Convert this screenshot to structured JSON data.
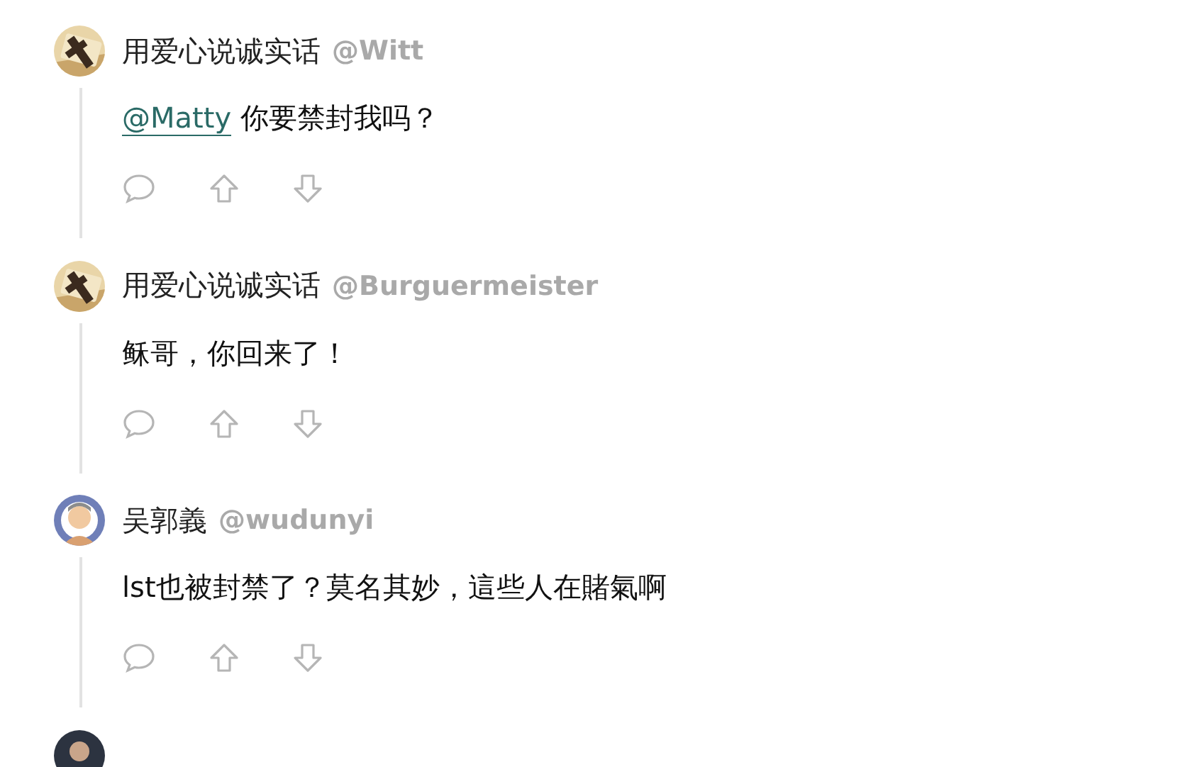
{
  "comments": [
    {
      "kind": "full",
      "author": "用爱心说诚实话",
      "handle": "@Witt",
      "mention": "@Matty",
      "text": "你要禁封我吗？"
    },
    {
      "kind": "full",
      "author": "用爱心说诚实话",
      "handle": "@Burguermeister",
      "text": "稣哥，你回来了！"
    },
    {
      "kind": "full",
      "author": "吴郭義",
      "handle": "@wudunyi",
      "text": "lst也被封禁了？莫名其妙，這些人在賭氣啊"
    },
    {
      "kind": "cut"
    }
  ]
}
